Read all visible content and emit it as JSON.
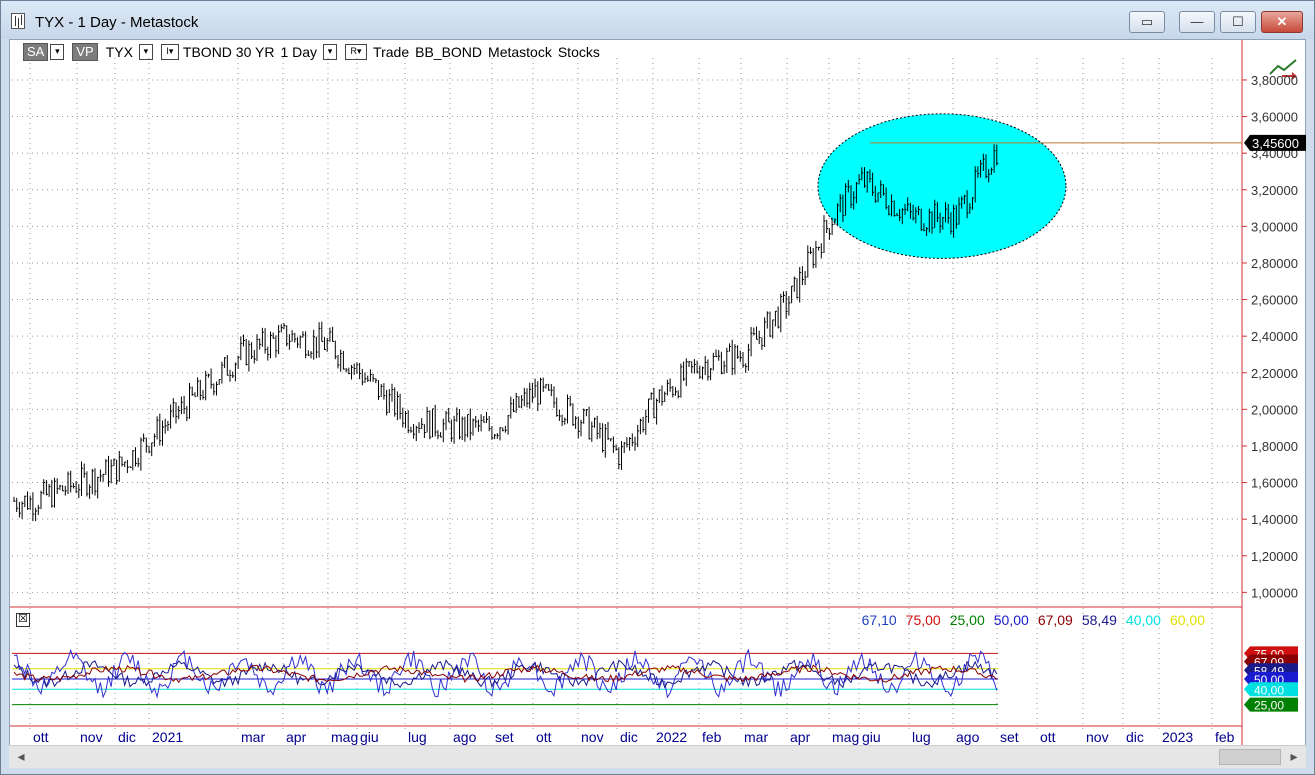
{
  "window": {
    "title": "TYX - 1 Day - Metastock",
    "buttons": [
      "restore-edit",
      "minimize",
      "maximize",
      "close"
    ]
  },
  "toolbar": {
    "sa_label": "SA",
    "vp_label": "VP",
    "symbol": "TYX",
    "i_label": "I▾",
    "description": "TBOND 30 YR",
    "timeframe": "1 Day",
    "r_label": "R▾",
    "trade_label": "Trade",
    "source": "BB_BOND",
    "app": "Metastock",
    "type": "Stocks"
  },
  "indicator": {
    "close_box": "☒",
    "legend": [
      {
        "text": "67,10",
        "color": "#1f3fbf"
      },
      {
        "text": "75,00",
        "color": "#d01010"
      },
      {
        "text": "25,00",
        "color": "#008000"
      },
      {
        "text": "50,00",
        "color": "#1a1ad0"
      },
      {
        "text": "67,09",
        "color": "#8b0000"
      },
      {
        "text": "58,49",
        "color": "#1a1a8b"
      },
      {
        "text": "40,00",
        "color": "#00e0e0"
      },
      {
        "text": "60,00",
        "color": "#e0e000"
      }
    ],
    "right_tags": [
      {
        "text": "75,00",
        "color": "#d01010"
      },
      {
        "text": "67,09",
        "color": "#8b0000"
      },
      {
        "text": "58,49",
        "color": "#1a1a8b"
      },
      {
        "text": "50,00",
        "color": "#1a1ad0"
      },
      {
        "text": "40,00",
        "color": "#00e0e0"
      },
      {
        "text": "25,00",
        "color": "#008000"
      }
    ]
  },
  "price_axis": [
    "3,80000",
    "3,60000",
    "3,40000",
    "3,20000",
    "3,00000",
    "2,80000",
    "2,60000",
    "2,40000",
    "2,20000",
    "2,00000",
    "1,80000",
    "1,60000",
    "1,40000",
    "1,20000",
    "1,00000"
  ],
  "last_price": "3,45600",
  "month_axis": [
    "ott",
    "nov",
    "dic",
    "2021",
    "mar",
    "apr",
    "mag",
    "giu",
    "lug",
    "ago",
    "set",
    "ott",
    "nov",
    "dic",
    "2022",
    "feb",
    "mar",
    "apr",
    "mag",
    "giu",
    "lug",
    "ago",
    "set",
    "ott",
    "nov",
    "dic",
    "2023",
    "feb"
  ],
  "chart_data": {
    "type": "line",
    "title": "TYX - 1 Day",
    "ylim": [
      0.92,
      3.92
    ],
    "x": [
      "ott",
      "nov",
      "dic",
      "2021",
      "mar",
      "apr",
      "mag",
      "giu",
      "lug",
      "ago",
      "set",
      "ott",
      "nov",
      "dic",
      "2022",
      "feb",
      "mar",
      "apr",
      "mag",
      "giu",
      "lug",
      "ago",
      "set"
    ],
    "series": [
      {
        "name": "TYX",
        "values": [
          1.5,
          1.6,
          1.68,
          1.85,
          2.3,
          2.4,
          2.35,
          2.2,
          1.95,
          1.9,
          1.9,
          2.1,
          1.95,
          1.75,
          2.05,
          2.25,
          2.3,
          2.6,
          3.05,
          3.25,
          3.05,
          3.05,
          3.45
        ]
      }
    ],
    "indicator_values": {
      "series": [
        67.1,
        67.09,
        58.49
      ],
      "levels": [
        75.0,
        60.0,
        50.0,
        40.0,
        25.0
      ]
    }
  }
}
